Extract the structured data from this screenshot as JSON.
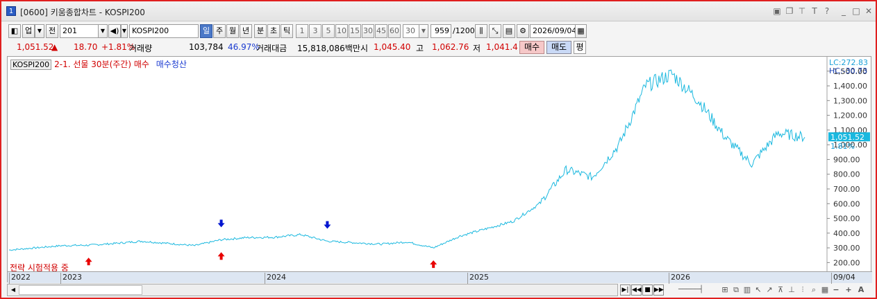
{
  "window": {
    "number": "1",
    "title": "[0600] 키움종합차트 - KOSPI200",
    "buttons": [
      "screen-icon",
      "copy-icon",
      "pin-icon",
      "font-icon",
      "help-icon",
      "minimize-icon",
      "maximize-icon",
      "close-icon"
    ]
  },
  "toolbar": {
    "market": "업",
    "view": "전",
    "code": "201",
    "name": "KOSPI200",
    "periods": [
      "일",
      "주",
      "월",
      "년",
      "분",
      "초",
      "틱"
    ],
    "selected_period": "일",
    "minutes": [
      "1",
      "3",
      "5",
      "10",
      "15",
      "30",
      "45",
      "60"
    ],
    "interval_value": "30",
    "count": "959",
    "count_total": "/1200",
    "date": "2026/09/04"
  },
  "info": {
    "price": "1,051.52",
    "change_arrow": "▲",
    "change": "18.70",
    "change_pct": "+1.81%",
    "volume_label": "거래량",
    "volume": "103,784",
    "volume_pct": "46.97%",
    "amount_label": "거래대금",
    "amount": "15,818,086백만",
    "open_label": "시",
    "open": "1,045.40",
    "high_label": "고",
    "high": "1,062.76",
    "low_label": "저",
    "low": "1,041.4",
    "buy": "매수",
    "sell": "매도",
    "pyeong": "평"
  },
  "legend": {
    "symbol": "KOSPI200",
    "strategy": "2-1. 선물 30분(주간) 매수",
    "strategy_exit": "매수청산",
    "status": "전략 시험적용 중"
  },
  "axis_right": {
    "lc": "LC:272.83",
    "hc": "HC:-30.73",
    "current": "1,051.52",
    "current_pct": "1.81%"
  },
  "bottom": {
    "tool_icons": [
      "play-icon",
      "rewind-icon",
      "stop-icon",
      "fast-forward-icon",
      "slider-icon",
      "grid-icon",
      "dual-grid-icon",
      "layout-icon",
      "arrow-icon",
      "arrow-right-icon",
      "align-icon",
      "vertical-icon",
      "bars-icon",
      "magnify-icon",
      "minus-icon",
      "plus-icon",
      "text-icon"
    ],
    "zoom_labels": [
      "−",
      "+",
      "A"
    ]
  },
  "colors": {
    "line": "#1ab8df",
    "buy_marker": "#e80000",
    "exit_marker": "#0015d0",
    "axis_bg": "#dde6f2",
    "price_badge": "#1ab8df"
  },
  "chart_data": {
    "type": "line",
    "series": [
      {
        "name": "KOSPI200",
        "values": [
          [
            "2022-09",
            285
          ],
          [
            "2022-11",
            300
          ],
          [
            "2023-01",
            315
          ],
          [
            "2023-03",
            318
          ],
          [
            "2023-05",
            330
          ],
          [
            "2023-07",
            345
          ],
          [
            "2023-09",
            330
          ],
          [
            "2023-11",
            315
          ],
          [
            "2024-01",
            355
          ],
          [
            "2024-03",
            370
          ],
          [
            "2024-05",
            372
          ],
          [
            "2024-07",
            390
          ],
          [
            "2024-09",
            345
          ],
          [
            "2024-11",
            335
          ],
          [
            "2025-01",
            325
          ],
          [
            "2025-03",
            340
          ],
          [
            "2025-04",
            300
          ],
          [
            "2025-06",
            380
          ],
          [
            "2025-08",
            430
          ],
          [
            "2025-10",
            480
          ],
          [
            "2025-12",
            600
          ],
          [
            "2026-02",
            830
          ],
          [
            "2026-03",
            780
          ],
          [
            "2026-04",
            1000
          ],
          [
            "2026-05",
            1400
          ],
          [
            "2026-05b",
            1480
          ],
          [
            "2026-06",
            1300
          ],
          [
            "2026-07",
            1050
          ],
          [
            "2026-07b",
            870
          ],
          [
            "2026-08",
            1080
          ],
          [
            "2026-09",
            1051.52
          ]
        ]
      }
    ],
    "xlabels": [
      "2022",
      "2023",
      "2024",
      "2025",
      "2026",
      "09/04"
    ],
    "yticks": [
      "200.00",
      "300.00",
      "400.00",
      "500.00",
      "600.00",
      "700.00",
      "800.00",
      "900.00",
      "1,000.00",
      "1,100.00",
      "1,200.00",
      "1,300.00",
      "1,400.00",
      "1,500.00"
    ],
    "ylim": [
      150,
      1560
    ],
    "buy_signals": [
      "2023-02",
      "2024-01",
      "2025-04"
    ],
    "exit_signals": [
      "2023-12",
      "2024-09"
    ]
  }
}
